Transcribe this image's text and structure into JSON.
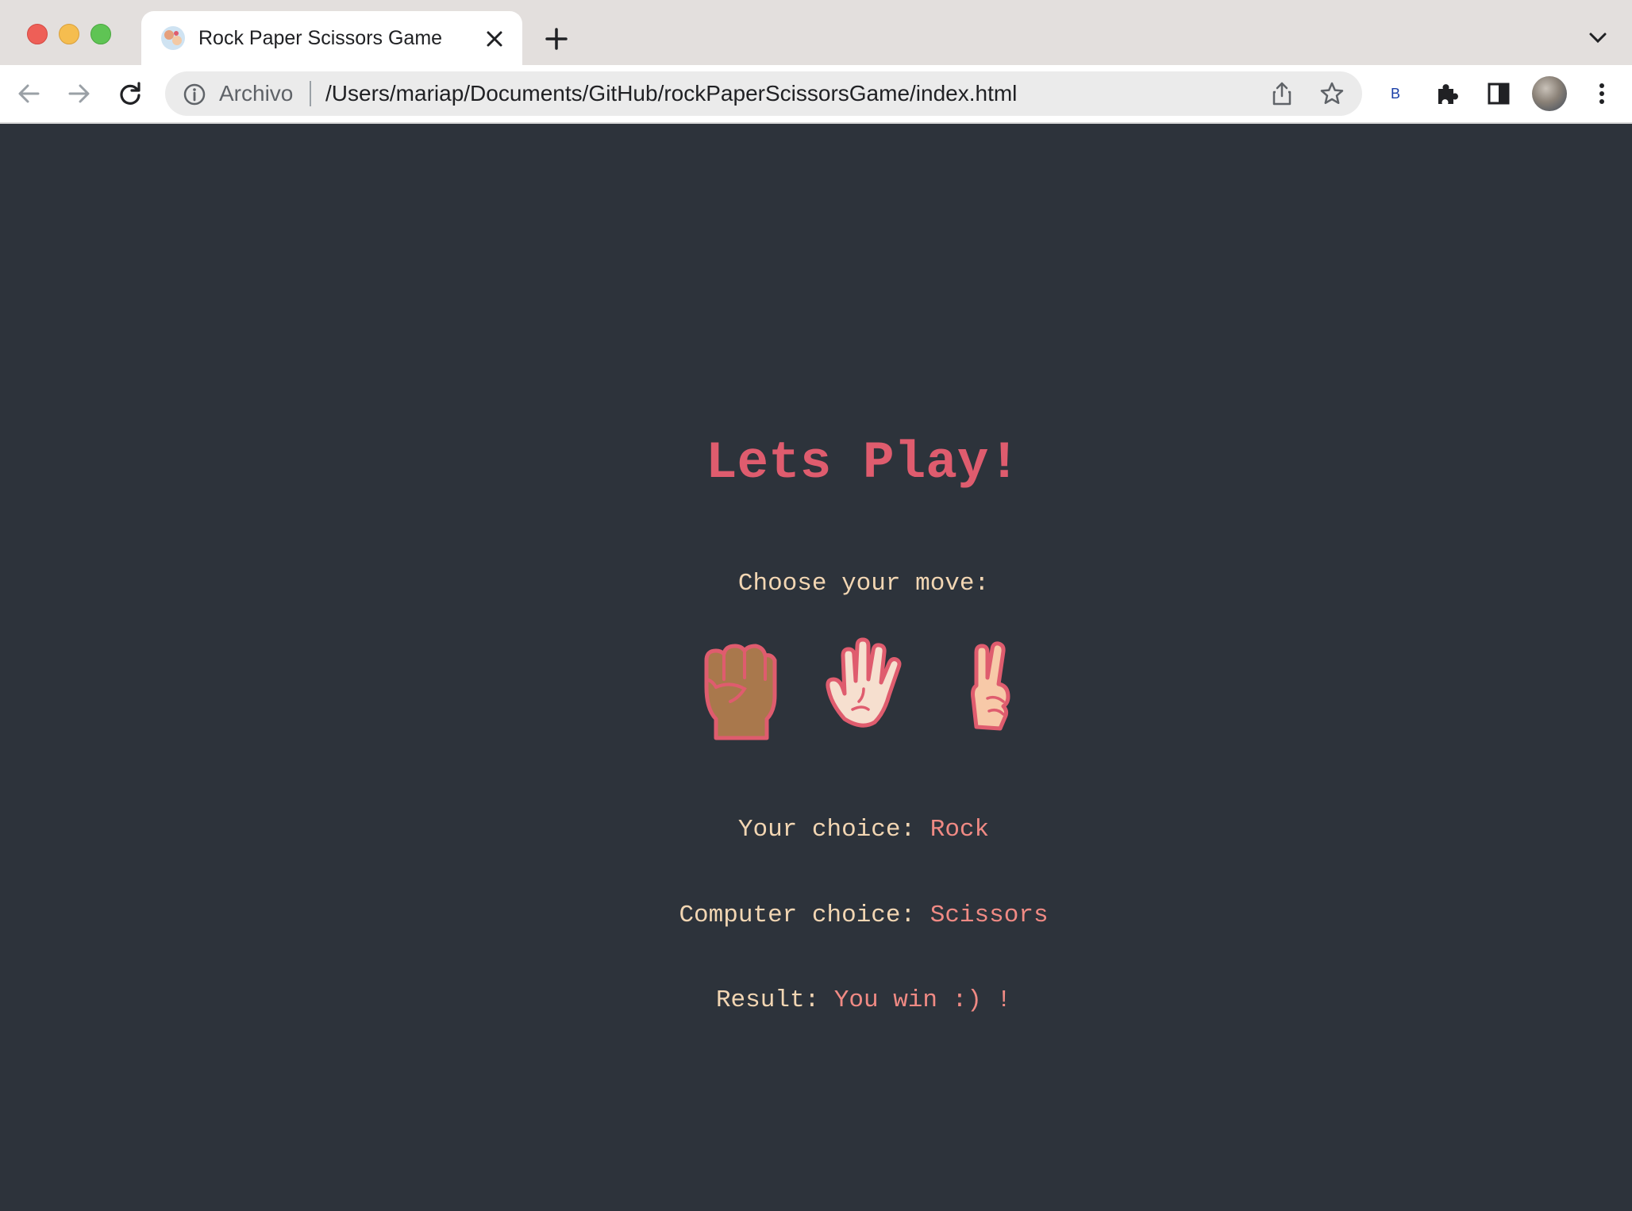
{
  "browser": {
    "tab_title": "Rock Paper Scissors Game",
    "scheme_label": "Archivo",
    "url": "/Users/mariap/Documents/GitHub/rockPaperScissorsGame/index.html",
    "extension_label": "B"
  },
  "game": {
    "title": "Lets Play!",
    "prompt": "Choose your move:",
    "moves": [
      {
        "name": "rock",
        "icon": "raised-fist-icon"
      },
      {
        "name": "paper",
        "icon": "raised-hand-icon"
      },
      {
        "name": "scissors",
        "icon": "victory-hand-icon"
      }
    ],
    "your_choice_label": "Your choice:",
    "your_choice_value": "Rock",
    "computer_choice_label": "Computer choice:",
    "computer_choice_value": "Scissors",
    "result_label": "Result:",
    "result_value": "You win :) !"
  },
  "colors": {
    "background": "#2d333b",
    "title": "#df5c6e",
    "text": "#f2d6b3",
    "value": "#f08a84"
  }
}
